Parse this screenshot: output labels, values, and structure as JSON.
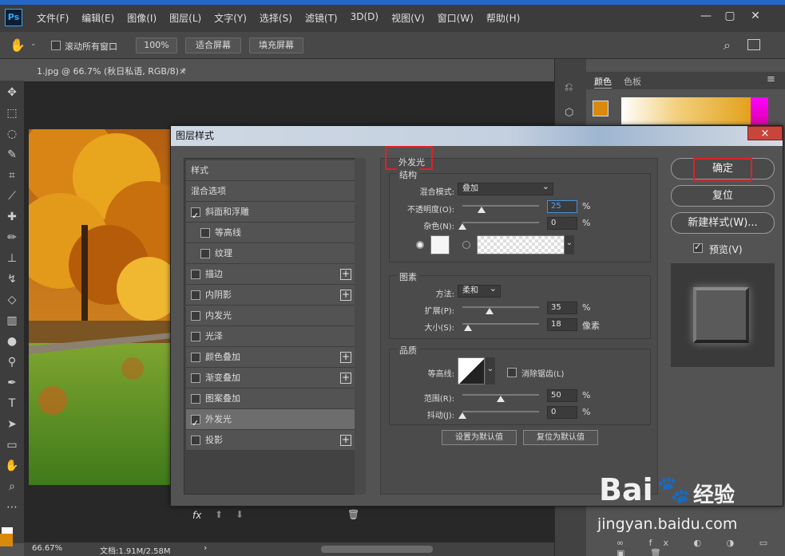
{
  "menubar": {
    "app_icon": "Ps",
    "items": [
      "文件(F)",
      "编辑(E)",
      "图像(I)",
      "图层(L)",
      "文字(Y)",
      "选择(S)",
      "滤镜(T)",
      "3D(D)",
      "视图(V)",
      "窗口(W)",
      "帮助(H)"
    ]
  },
  "options": {
    "scroll_all": "滚动所有窗口",
    "zoom": "100%",
    "fit_screen": "适合屏幕",
    "fill_screen": "填充屏幕"
  },
  "document": {
    "tab_title": "1.jpg @ 66.7% (秋日私语, RGB/8) *",
    "zoom": "66.67%",
    "doc_info": "文档:1.91M/2.58M"
  },
  "color_panel": {
    "tabs": [
      "颜色",
      "色板"
    ],
    "fg_color": "#d98a0c"
  },
  "dialog": {
    "title": "图层样式",
    "close": "×",
    "style_list": [
      {
        "label": "样式",
        "checkbox": false,
        "checked": false,
        "plus": false,
        "selected": false,
        "indent": false
      },
      {
        "label": "混合选项",
        "checkbox": false,
        "checked": false,
        "plus": false,
        "selected": false,
        "indent": false
      },
      {
        "label": "斜面和浮雕",
        "checkbox": true,
        "checked": true,
        "plus": false,
        "selected": false,
        "indent": false
      },
      {
        "label": "等高线",
        "checkbox": true,
        "checked": false,
        "plus": false,
        "selected": false,
        "indent": true
      },
      {
        "label": "纹理",
        "checkbox": true,
        "checked": false,
        "plus": false,
        "selected": false,
        "indent": true
      },
      {
        "label": "描边",
        "checkbox": true,
        "checked": false,
        "plus": true,
        "selected": false,
        "indent": false
      },
      {
        "label": "内阴影",
        "checkbox": true,
        "checked": false,
        "plus": true,
        "selected": false,
        "indent": false
      },
      {
        "label": "内发光",
        "checkbox": true,
        "checked": false,
        "plus": false,
        "selected": false,
        "indent": false
      },
      {
        "label": "光泽",
        "checkbox": true,
        "checked": false,
        "plus": false,
        "selected": false,
        "indent": false
      },
      {
        "label": "颜色叠加",
        "checkbox": true,
        "checked": false,
        "plus": true,
        "selected": false,
        "indent": false
      },
      {
        "label": "渐变叠加",
        "checkbox": true,
        "checked": false,
        "plus": true,
        "selected": false,
        "indent": false
      },
      {
        "label": "图案叠加",
        "checkbox": true,
        "checked": false,
        "plus": false,
        "selected": false,
        "indent": false
      },
      {
        "label": "外发光",
        "checkbox": true,
        "checked": true,
        "plus": false,
        "selected": true,
        "indent": false
      },
      {
        "label": "投影",
        "checkbox": true,
        "checked": false,
        "plus": true,
        "selected": false,
        "indent": false
      }
    ],
    "fx_label": "fx",
    "section_title": "外发光",
    "structure": {
      "title": "结构",
      "blend_mode_label": "混合模式:",
      "blend_mode": "叠加",
      "opacity_label": "不透明度(O):",
      "opacity": "25",
      "opacity_value": 25,
      "noise_label": "杂色(N):",
      "noise": "0",
      "noise_value": 0,
      "percent": "%"
    },
    "elements": {
      "title": "图素",
      "technique_label": "方法:",
      "technique": "柔和",
      "spread_label": "扩展(P):",
      "spread": "35",
      "spread_value": 35,
      "size_label": "大小(S):",
      "size": "18",
      "size_value": 18,
      "size_unit": "像素",
      "percent": "%"
    },
    "quality": {
      "title": "品质",
      "contour_label": "等高线:",
      "antialias_label": "消除锯齿(L)",
      "range_label": "范围(R):",
      "range": "50",
      "range_value": 50,
      "jitter_label": "抖动(J):",
      "jitter": "0",
      "jitter_value": 0,
      "percent": "%"
    },
    "make_default": "设置为默认值",
    "reset_default": "复位为默认值",
    "ok": "确定",
    "reset": "复位",
    "new_style": "新建样式(W)...",
    "preview_label": "预览(V)"
  },
  "watermark": {
    "brand": "Bai",
    "brand2": "经验",
    "url": "jingyan.baidu.com"
  }
}
